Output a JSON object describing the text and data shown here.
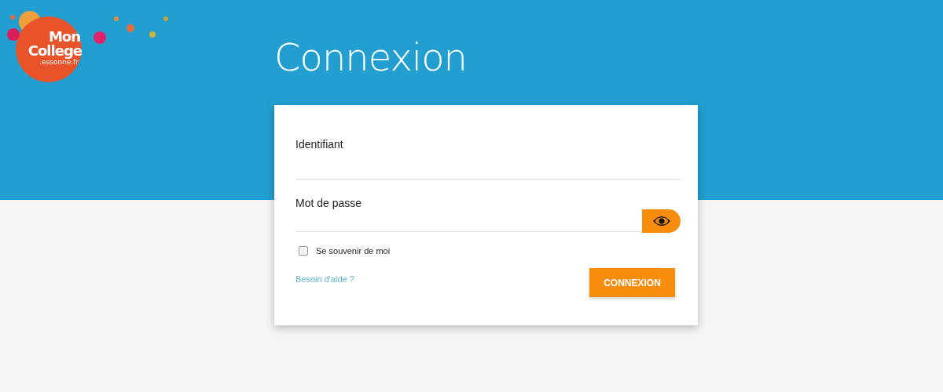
{
  "logo": {
    "lines": [
      "Mon",
      "College",
      ".essonne.fr"
    ]
  },
  "title": "Connexion",
  "form": {
    "fields": [
      {
        "label": "Identifiant",
        "kind": "text"
      },
      {
        "label": "Mot de passe",
        "kind": "password"
      }
    ],
    "remember": {
      "label": "Se souvenir de moi",
      "checked": false
    },
    "help_link": "Besoin d'aide ?",
    "submit": "CONNEXION"
  }
}
